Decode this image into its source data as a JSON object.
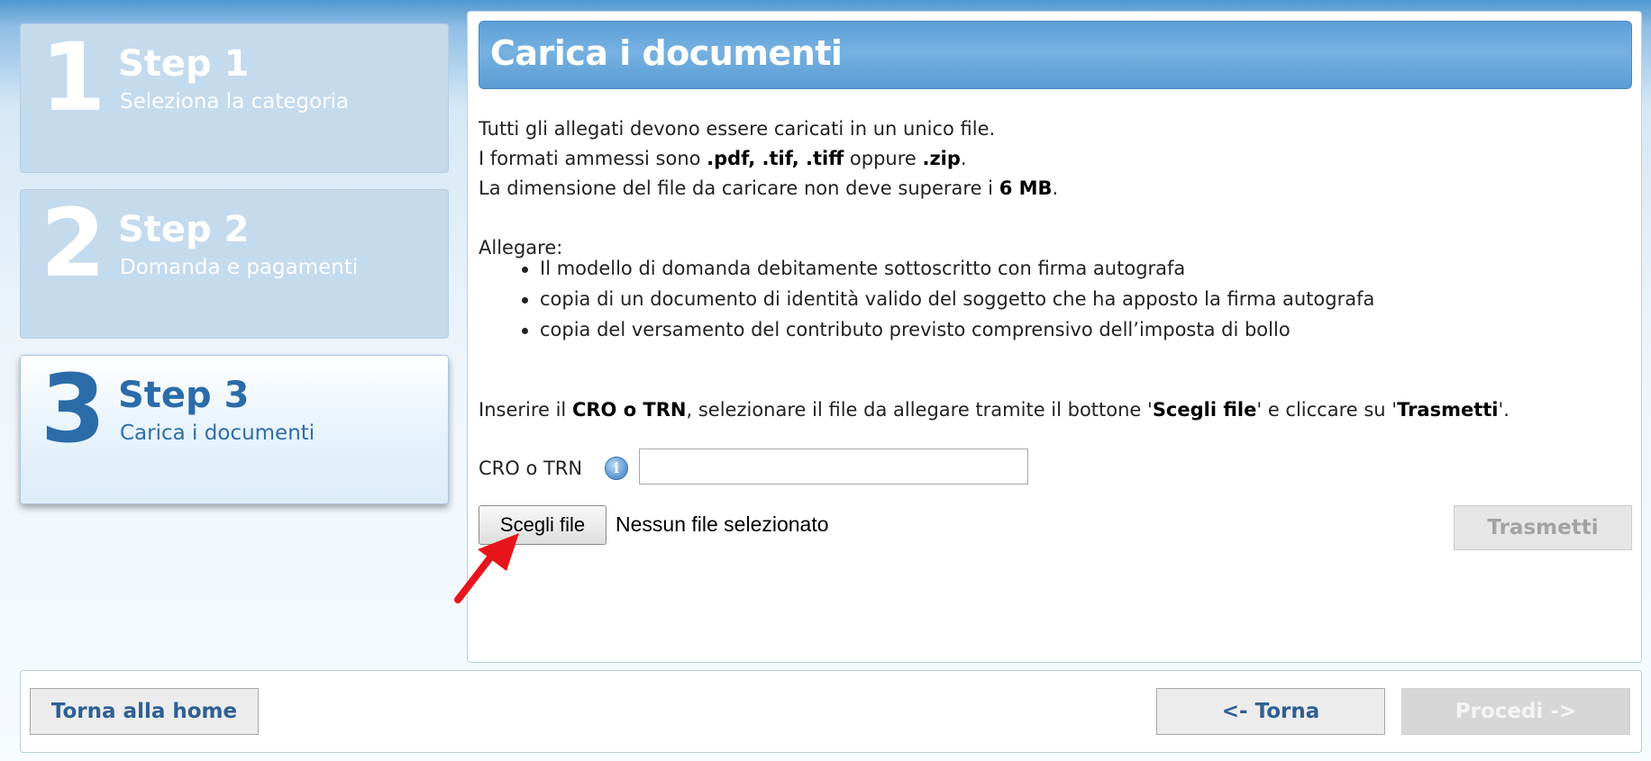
{
  "steps": [
    {
      "number": "1",
      "title": "Step 1",
      "subtitle": "Seleziona la categoria"
    },
    {
      "number": "2",
      "title": "Step 2",
      "subtitle": "Domanda e pagamenti"
    },
    {
      "number": "3",
      "title": "Step 3",
      "subtitle": "Carica i documenti"
    }
  ],
  "main": {
    "title": "Carica i documenti",
    "intro": {
      "line1": "Tutti gli allegati devono essere caricati in un unico file.",
      "line2_pre": "I formati ammessi sono ",
      "line2_formats": ".pdf, .tif, .tiff",
      "line2_mid": " oppure ",
      "line2_zip": ".zip",
      "line2_end": ".",
      "line3_pre": "La dimensione del file da caricare non deve superare i ",
      "line3_size": "6 MB",
      "line3_end": "."
    },
    "attach_heading": "Allegare:",
    "attach_items": [
      "Il modello di domanda debitamente sottoscritto con firma autografa",
      "copia di un documento di identità valido del soggetto che ha apposto la firma autografa",
      "copia del versamento del contributo previsto comprensivo dell’imposta di bollo"
    ],
    "instruction": {
      "pre": "Inserire il ",
      "cro": "CRO o TRN",
      "mid1": ", selezionare il file da allegare tramite il bottone '",
      "choose": "Scegli file",
      "mid2": "' e cliccare su '",
      "send": "Trasmetti",
      "end": "'."
    },
    "cro_label": "CRO o TRN",
    "cro_value": "",
    "info_icon": "i",
    "file_button": "Scegli file",
    "file_status": "Nessun file selezionato",
    "transmit_button": "Trasmetti"
  },
  "footer": {
    "home_button": "Torna alla home",
    "back_button": "<- Torna",
    "next_button": "Procedi ->"
  },
  "colors": {
    "accent": "#5c9fd7",
    "active_step_text": "#2b6ca8",
    "annotation_arrow": "#e8141c"
  }
}
